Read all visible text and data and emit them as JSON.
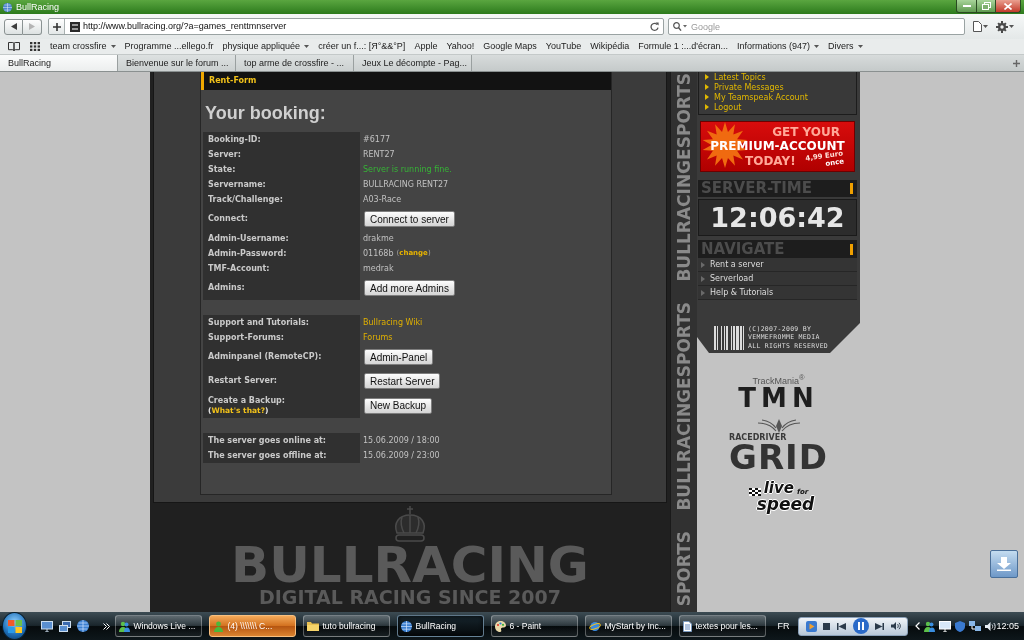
{
  "window": {
    "title": "BullRacing"
  },
  "toolbar": {
    "url": "http://www.bullracing.org/?a=games_renttmnserver",
    "search": {
      "placeholder": "Google"
    }
  },
  "bookmarks": [
    {
      "label": "team crossfire",
      "menu": true
    },
    {
      "label": "Programme ...ellego.fr",
      "menu": false
    },
    {
      "label": "physique appliquée",
      "menu": true
    },
    {
      "label": "créer un f...: [Я°&&°P]",
      "menu": false
    },
    {
      "label": "Apple",
      "menu": false
    },
    {
      "label": "Yahoo!",
      "menu": false
    },
    {
      "label": "Google Maps",
      "menu": false
    },
    {
      "label": "YouTube",
      "menu": false
    },
    {
      "label": "Wikipédia",
      "menu": false
    },
    {
      "label": "Formule 1 :...d'écran...",
      "menu": false
    },
    {
      "label": "Informations (947)",
      "menu": true
    },
    {
      "label": "Divers",
      "menu": true
    }
  ],
  "tabs": [
    {
      "label": "BullRacing",
      "selected": true
    },
    {
      "label": "Bienvenue sur le forum ...",
      "selected": false
    },
    {
      "label": "top arme de crossfire - ...",
      "selected": false
    },
    {
      "label": "Jeux Le décompte - Pag...",
      "selected": false
    }
  ],
  "form": {
    "header": "Rent-Form",
    "title": "Your booking:",
    "sections": [
      {
        "rows": [
          {
            "kind": "text",
            "label": "Booking-ID:",
            "value": "#6177"
          },
          {
            "kind": "text",
            "label": "Server:",
            "value": "RENT27"
          },
          {
            "kind": "status",
            "label": "State:",
            "value": "Server is running fine."
          },
          {
            "kind": "text",
            "label": "Servername:",
            "value": "BULLRACING RENT27"
          },
          {
            "kind": "text",
            "label": "Track/Challenge:",
            "value": "A03-Race"
          },
          {
            "kind": "button",
            "label": "Connect:",
            "value": "Connect to server"
          },
          {
            "kind": "text",
            "label": "Admin-Username:",
            "value": "drakme"
          },
          {
            "kind": "text",
            "label": "Admin-Password:",
            "value": "01168b",
            "value_link": "(**change**)"
          },
          {
            "kind": "text",
            "label": "TMF-Account:",
            "value": "medrak"
          },
          {
            "kind": "button",
            "label": "Admins:",
            "value": "Add more Admins"
          }
        ]
      },
      {
        "rows": [
          {
            "kind": "link",
            "label": "Support and Tutorials:",
            "value": "Bullracing Wiki"
          },
          {
            "kind": "link",
            "label": "Support-Forums:",
            "value": "Forums"
          },
          {
            "kind": "button",
            "label": "Adminpanel (RemoteCP):",
            "value": "Admin-Panel"
          },
          {
            "kind": "button",
            "label": "Restart Server:",
            "value": "Restart Server"
          },
          {
            "kind": "button",
            "label": "Create a Backup:",
            "label_link": "(**What's that?**)",
            "value": "New Backup"
          }
        ]
      },
      {
        "rows": [
          {
            "kind": "text",
            "label": "The server goes online at:",
            "value": "15.06.2009 / 18:00"
          },
          {
            "kind": "text",
            "label": "The server goes offline at:",
            "value": "15.06.2009 / 23:00"
          }
        ]
      }
    ]
  },
  "footer_logo": {
    "name": "BULLRACING",
    "tagline": "DIGITAL RACING SINCE 2007"
  },
  "side_strip": [
    "BULLRACINGESPORTS",
    "BULLRACINGESPORTS",
    "SPORTS"
  ],
  "sidebar": {
    "account_links": [
      "Latest Topics",
      "Private Messages",
      "My Teamspeak Account",
      "Logout"
    ],
    "premium_banner": {
      "lines": [
        "GET YOUR",
        "PREMIUM-ACCOUNT",
        "TODAY!"
      ],
      "price": "4,99 Euro",
      "price_note": "once"
    },
    "server_time": {
      "heading": "SERVER-TIME",
      "time": "12:06:42"
    },
    "navigate": {
      "heading": "NAVIGATE",
      "items": [
        "Rent a server",
        "Serverload",
        "Help & Tutorials"
      ]
    },
    "copyright": [
      "(C)2007-2009 BY",
      "VEMMEFROMME MEDIA",
      "ALL RIGHTS RESERVED"
    ],
    "logos": [
      {
        "kind": "trackmania",
        "texts": [
          "TrackMania$^{®}$",
          "TMN"
        ]
      },
      {
        "kind": "grid",
        "texts": [
          "RACEDRIVER",
          "GRID"
        ]
      },
      {
        "kind": "lfs",
        "texts": [
          "live",
          "for",
          "speed"
        ]
      }
    ]
  },
  "taskbar": {
    "tasks": [
      {
        "kind": "messenger",
        "label": "Windows Live ...",
        "selected": false,
        "flashing": false
      },
      {
        "kind": "conversation",
        "label": "(4) \\\\\\\\\\\\\\ C...",
        "selected": false,
        "flashing": true
      },
      {
        "kind": "folder",
        "label": "tuto bullracing",
        "selected": false,
        "flashing": false
      },
      {
        "kind": "browser",
        "label": "BullRacing",
        "selected": true,
        "flashing": false
      },
      {
        "kind": "paint",
        "label": "6 - Paint",
        "selected": false,
        "flashing": false
      },
      {
        "kind": "web",
        "label": "MyStart by Inc...",
        "selected": false,
        "flashing": false
      },
      {
        "kind": "document",
        "label": "textes pour les...",
        "selected": false,
        "flashing": false
      }
    ],
    "language": "FR",
    "clock": "12:05"
  }
}
